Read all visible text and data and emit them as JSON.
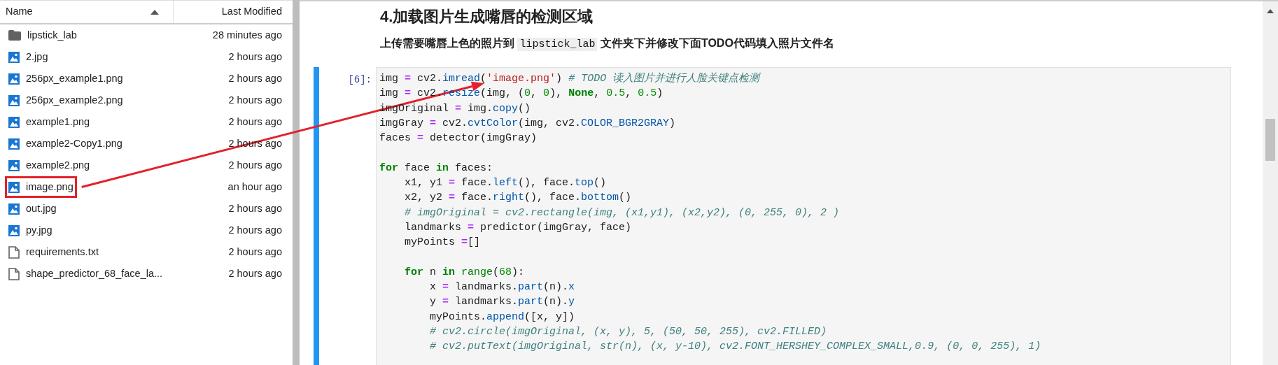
{
  "file_browser": {
    "columns": [
      {
        "label": "Name",
        "sorted": true
      },
      {
        "label": "Last Modified",
        "sorted": false
      }
    ],
    "files": [
      {
        "kind": "folder",
        "name": "lipstick_lab",
        "modified": "28 minutes ago",
        "highlighted": false
      },
      {
        "kind": "image",
        "name": "2.jpg",
        "modified": "2 hours ago",
        "highlighted": false
      },
      {
        "kind": "image",
        "name": "256px_example1.png",
        "modified": "2 hours ago",
        "highlighted": false
      },
      {
        "kind": "image",
        "name": "256px_example2.png",
        "modified": "2 hours ago",
        "highlighted": false
      },
      {
        "kind": "image",
        "name": "example1.png",
        "modified": "2 hours ago",
        "highlighted": false
      },
      {
        "kind": "image",
        "name": "example2-Copy1.png",
        "modified": "2 hours ago",
        "highlighted": false
      },
      {
        "kind": "image",
        "name": "example2.png",
        "modified": "2 hours ago",
        "highlighted": false
      },
      {
        "kind": "image",
        "name": "image.png",
        "modified": "an hour ago",
        "highlighted": true
      },
      {
        "kind": "image",
        "name": "out.jpg",
        "modified": "2 hours ago",
        "highlighted": false
      },
      {
        "kind": "image",
        "name": "py.jpg",
        "modified": "2 hours ago",
        "highlighted": false
      },
      {
        "kind": "text",
        "name": "requirements.txt",
        "modified": "2 hours ago",
        "highlighted": false
      },
      {
        "kind": "text",
        "name": "shape_predictor_68_face_la...",
        "modified": "2 hours ago",
        "highlighted": false
      }
    ]
  },
  "notebook": {
    "heading": "4.加载图片生成嘴唇的检测区域",
    "instruction": {
      "before": "上传需要嘴唇上色的照片到 ",
      "code": "lipstick_lab",
      "after": " 文件夹下并修改下面TODO代码填入照片文件名"
    },
    "cell": {
      "prompt": "[6]:",
      "active": true,
      "lines": [
        {
          "kind": "code",
          "tokens": [
            {
              "kind": "plain",
              "text": "img "
            },
            {
              "kind": "op",
              "text": "="
            },
            {
              "kind": "plain",
              "text": " cv2."
            },
            {
              "kind": "property",
              "text": "imread"
            },
            {
              "kind": "plain",
              "text": "("
            },
            {
              "kind": "string",
              "text": "'image.png'"
            },
            {
              "kind": "plain",
              "text": ") "
            },
            {
              "kind": "comment",
              "text": "# TODO 读入图片并进行人脸关键点检测"
            }
          ]
        },
        {
          "kind": "code",
          "tokens": [
            {
              "kind": "plain",
              "text": "img "
            },
            {
              "kind": "op",
              "text": "="
            },
            {
              "kind": "plain",
              "text": " cv2."
            },
            {
              "kind": "property",
              "text": "resize"
            },
            {
              "kind": "plain",
              "text": "(img, ("
            },
            {
              "kind": "number",
              "text": "0"
            },
            {
              "kind": "plain",
              "text": ", "
            },
            {
              "kind": "number",
              "text": "0"
            },
            {
              "kind": "plain",
              "text": "), "
            },
            {
              "kind": "keyword",
              "text": "None"
            },
            {
              "kind": "plain",
              "text": ", "
            },
            {
              "kind": "number",
              "text": "0.5"
            },
            {
              "kind": "plain",
              "text": ", "
            },
            {
              "kind": "number",
              "text": "0.5"
            },
            {
              "kind": "plain",
              "text": ")"
            }
          ]
        },
        {
          "kind": "code",
          "tokens": [
            {
              "kind": "plain",
              "text": "imgOriginal "
            },
            {
              "kind": "op",
              "text": "="
            },
            {
              "kind": "plain",
              "text": " img."
            },
            {
              "kind": "property",
              "text": "copy"
            },
            {
              "kind": "plain",
              "text": "()"
            }
          ]
        },
        {
          "kind": "code",
          "tokens": [
            {
              "kind": "plain",
              "text": "imgGray "
            },
            {
              "kind": "op",
              "text": "="
            },
            {
              "kind": "plain",
              "text": " cv2."
            },
            {
              "kind": "property",
              "text": "cvtColor"
            },
            {
              "kind": "plain",
              "text": "(img, cv2."
            },
            {
              "kind": "property",
              "text": "COLOR_BGR2GRAY"
            },
            {
              "kind": "plain",
              "text": ")"
            }
          ]
        },
        {
          "kind": "code",
          "tokens": [
            {
              "kind": "plain",
              "text": "faces "
            },
            {
              "kind": "op",
              "text": "="
            },
            {
              "kind": "plain",
              "text": " detector(imgGray)"
            }
          ]
        },
        {
          "kind": "blank"
        },
        {
          "kind": "code",
          "tokens": [
            {
              "kind": "keyword",
              "text": "for"
            },
            {
              "kind": "plain",
              "text": " face "
            },
            {
              "kind": "keyword",
              "text": "in"
            },
            {
              "kind": "plain",
              "text": " faces:"
            }
          ]
        },
        {
          "kind": "code",
          "tokens": [
            {
              "kind": "plain",
              "text": "    x1, y1 "
            },
            {
              "kind": "op",
              "text": "="
            },
            {
              "kind": "plain",
              "text": " face."
            },
            {
              "kind": "property",
              "text": "left"
            },
            {
              "kind": "plain",
              "text": "(), face."
            },
            {
              "kind": "property",
              "text": "top"
            },
            {
              "kind": "plain",
              "text": "()"
            }
          ]
        },
        {
          "kind": "code",
          "tokens": [
            {
              "kind": "plain",
              "text": "    x2, y2 "
            },
            {
              "kind": "op",
              "text": "="
            },
            {
              "kind": "plain",
              "text": " face."
            },
            {
              "kind": "property",
              "text": "right"
            },
            {
              "kind": "plain",
              "text": "(), face."
            },
            {
              "kind": "property",
              "text": "bottom"
            },
            {
              "kind": "plain",
              "text": "()"
            }
          ]
        },
        {
          "kind": "code",
          "tokens": [
            {
              "kind": "comment",
              "text": "    # imgOriginal = cv2.rectangle(img, (x1,y1), (x2,y2), (0, 255, 0), 2 )"
            }
          ]
        },
        {
          "kind": "code",
          "tokens": [
            {
              "kind": "plain",
              "text": "    landmarks "
            },
            {
              "kind": "op",
              "text": "="
            },
            {
              "kind": "plain",
              "text": " predictor(imgGray, face)"
            }
          ]
        },
        {
          "kind": "code",
          "tokens": [
            {
              "kind": "plain",
              "text": "    myPoints "
            },
            {
              "kind": "op",
              "text": "="
            },
            {
              "kind": "plain",
              "text": "[]"
            }
          ]
        },
        {
          "kind": "blank"
        },
        {
          "kind": "code",
          "tokens": [
            {
              "kind": "keyword",
              "text": "    for"
            },
            {
              "kind": "plain",
              "text": " n "
            },
            {
              "kind": "keyword",
              "text": "in"
            },
            {
              "kind": "builtin",
              "text": " range"
            },
            {
              "kind": "plain",
              "text": "("
            },
            {
              "kind": "number",
              "text": "68"
            },
            {
              "kind": "plain",
              "text": "):"
            }
          ]
        },
        {
          "kind": "code",
          "tokens": [
            {
              "kind": "plain",
              "text": "        x "
            },
            {
              "kind": "op",
              "text": "="
            },
            {
              "kind": "plain",
              "text": " landmarks."
            },
            {
              "kind": "property",
              "text": "part"
            },
            {
              "kind": "plain",
              "text": "(n)."
            },
            {
              "kind": "property",
              "text": "x"
            }
          ]
        },
        {
          "kind": "code",
          "tokens": [
            {
              "kind": "plain",
              "text": "        y "
            },
            {
              "kind": "op",
              "text": "="
            },
            {
              "kind": "plain",
              "text": " landmarks."
            },
            {
              "kind": "property",
              "text": "part"
            },
            {
              "kind": "plain",
              "text": "(n)."
            },
            {
              "kind": "property",
              "text": "y"
            }
          ]
        },
        {
          "kind": "code",
          "tokens": [
            {
              "kind": "plain",
              "text": "        myPoints."
            },
            {
              "kind": "property",
              "text": "append"
            },
            {
              "kind": "plain",
              "text": "([x, y])"
            }
          ]
        },
        {
          "kind": "code",
          "tokens": [
            {
              "kind": "comment",
              "text": "        # cv2.circle(imgOriginal, (x, y), 5, (50, 50, 255), cv2.FILLED)"
            }
          ]
        },
        {
          "kind": "code",
          "tokens": [
            {
              "kind": "comment",
              "text": "        # cv2.putText(imgOriginal, str(n), (x, y-10), cv2.FONT_HERSHEY_COMPLEX_SMALL,0.9, (0, 0, 255), 1)"
            }
          ]
        }
      ]
    }
  }
}
